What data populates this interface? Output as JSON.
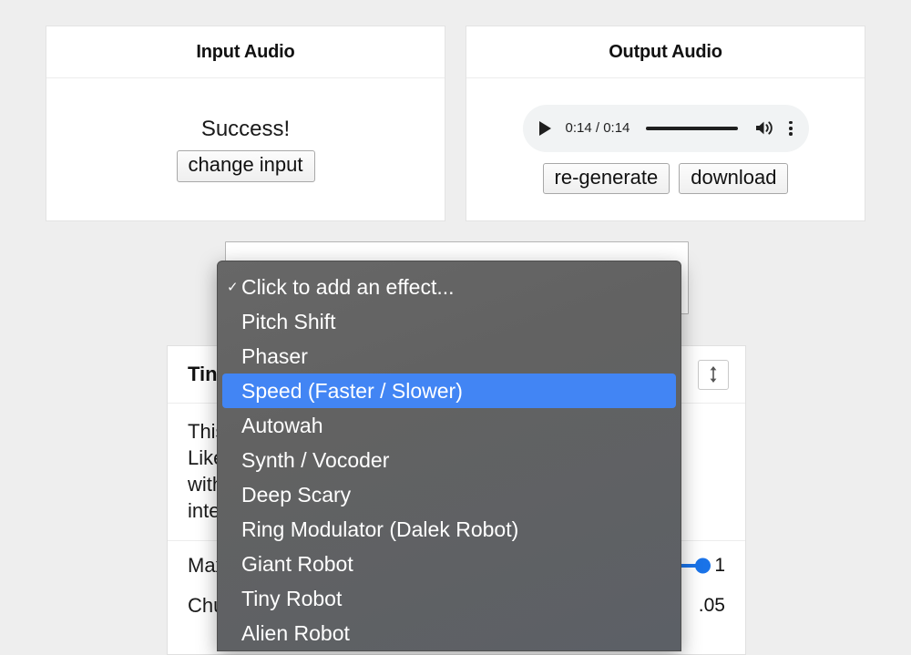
{
  "page": {
    "background_color": "#eeeeee",
    "accent_color": "#4285f4",
    "slider_color": "#1a73e8"
  },
  "input_panel": {
    "title": "Input Audio",
    "status_text": "Success!",
    "change_button": "change input"
  },
  "output_panel": {
    "title": "Output Audio",
    "player": {
      "play_icon": "play-icon",
      "time_display": "0:14 / 0:14",
      "volume_icon": "volume-icon",
      "menu_icon": "more-vertical-icon"
    },
    "regenerate_button": "re-generate",
    "download_button": "download"
  },
  "effect_select": {
    "placeholder": ""
  },
  "effect_dropdown": {
    "selected_index": 3,
    "checked_index": 0,
    "items": [
      {
        "label": "Click to add an effect...",
        "checked": true
      },
      {
        "label": "Pitch Shift",
        "checked": false
      },
      {
        "label": "Phaser",
        "checked": false
      },
      {
        "label": "Speed (Faster / Slower)",
        "checked": false
      },
      {
        "label": "Autowah",
        "checked": false
      },
      {
        "label": "Synth / Vocoder",
        "checked": false
      },
      {
        "label": "Deep Scary",
        "checked": false
      },
      {
        "label": "Ring Modulator (Dalek Robot)",
        "checked": false
      },
      {
        "label": "Giant Robot",
        "checked": false
      },
      {
        "label": "Tiny Robot",
        "checked": false
      },
      {
        "label": "Alien Robot",
        "checked": false
      }
    ]
  },
  "effect_card": {
    "title": "Tiny Robot",
    "resize_icon": "resize-vertical-icon",
    "description_line_1": "This effect makes the voice sound like a tiny robot.",
    "description_line_2": "Like a small mechanical creature, high pitched and",
    "description_line_3": "with a metallic buzzing quality added to the",
    "description_line_4": "interior of the sound.",
    "params": [
      {
        "label": "Max",
        "value": "1"
      },
      {
        "label": "Chunk",
        "value": ".05"
      }
    ]
  }
}
